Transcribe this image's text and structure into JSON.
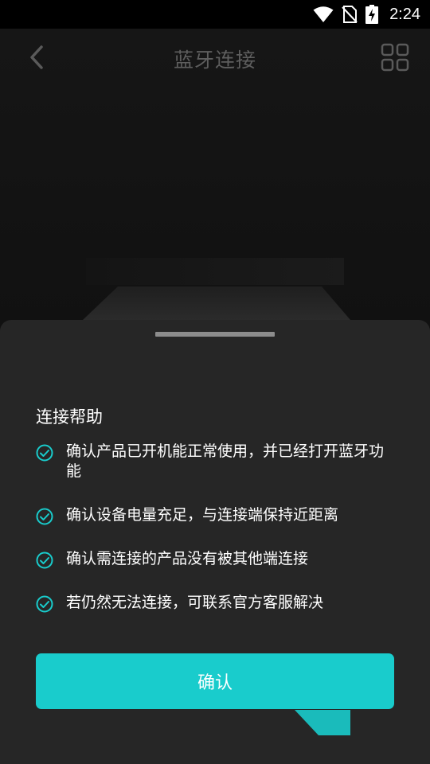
{
  "status_bar": {
    "time": "2:24",
    "icons": [
      "wifi-icon",
      "no-sim-icon",
      "battery-charging-icon"
    ]
  },
  "nav": {
    "title": "蓝牙连接",
    "back_icon": "chevron-left-icon",
    "menu_icon": "grid-icon"
  },
  "sheet": {
    "title": "连接帮助",
    "tips": [
      "确认产品已开机能正常使用，并已经打开蓝牙功能",
      "确认设备电量充足，与连接端保持近距离",
      "确认需连接的产品没有被其他端连接",
      "若仍然无法连接，可联系官方客服解决"
    ],
    "confirm_label": "确认"
  },
  "colors": {
    "accent": "#19cccc",
    "sheet_bg": "#262626",
    "title_muted": "#5e5e5e"
  }
}
